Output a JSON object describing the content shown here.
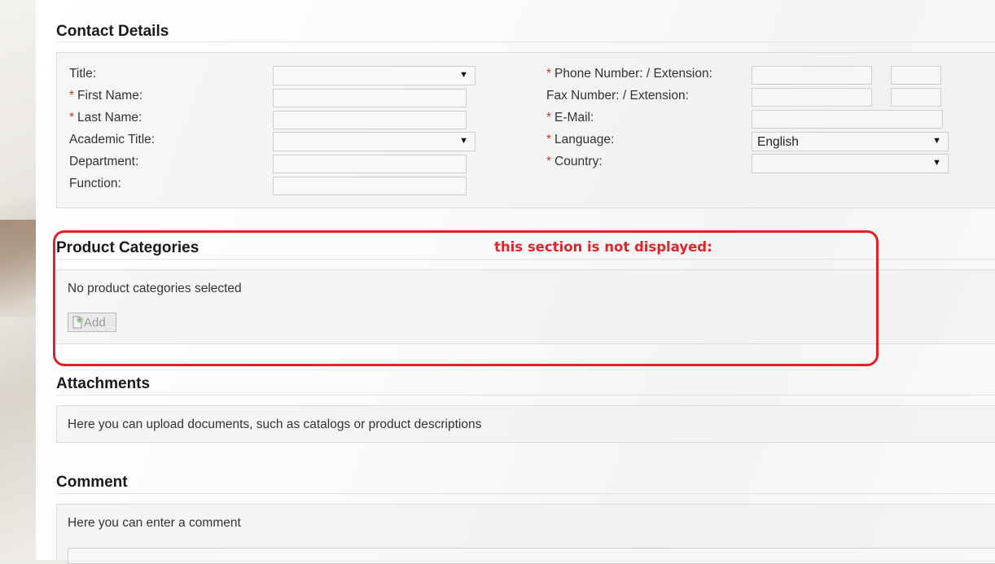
{
  "contact": {
    "title": "Contact Details",
    "left_fields": [
      {
        "label": "Title:",
        "required": false,
        "type": "select",
        "value": ""
      },
      {
        "label": "First Name:",
        "required": true,
        "type": "input",
        "value": ""
      },
      {
        "label": "Last Name:",
        "required": true,
        "type": "input",
        "value": ""
      },
      {
        "label": "Academic Title:",
        "required": false,
        "type": "select",
        "value": ""
      },
      {
        "label": "Department:",
        "required": false,
        "type": "input",
        "value": ""
      },
      {
        "label": "Function:",
        "required": false,
        "type": "input",
        "value": ""
      }
    ],
    "right_fields": [
      {
        "label": "Phone Number:  / Extension:",
        "required": true
      },
      {
        "label": "Fax Number:  / Extension:",
        "required": false
      },
      {
        "label": "E-Mail:",
        "required": true
      },
      {
        "label": "Language:",
        "required": true,
        "value": "English"
      },
      {
        "label": "Country:",
        "required": true,
        "value": ""
      }
    ],
    "required_marker": "*"
  },
  "product_categories": {
    "title": "Product Categories",
    "empty_text": "No product categories selected",
    "add_label": "Add"
  },
  "attachments": {
    "title": "Attachments",
    "hint": "Here you can upload documents, such as catalogs or product descriptions"
  },
  "comment": {
    "title": "Comment",
    "hint": "Here you can enter a comment"
  },
  "annotation": {
    "text": "this section is not displayed:",
    "color": "#e0202a"
  },
  "icons": {
    "add": "document-add-icon",
    "dropdown": "dropdown-arrow-icon"
  }
}
